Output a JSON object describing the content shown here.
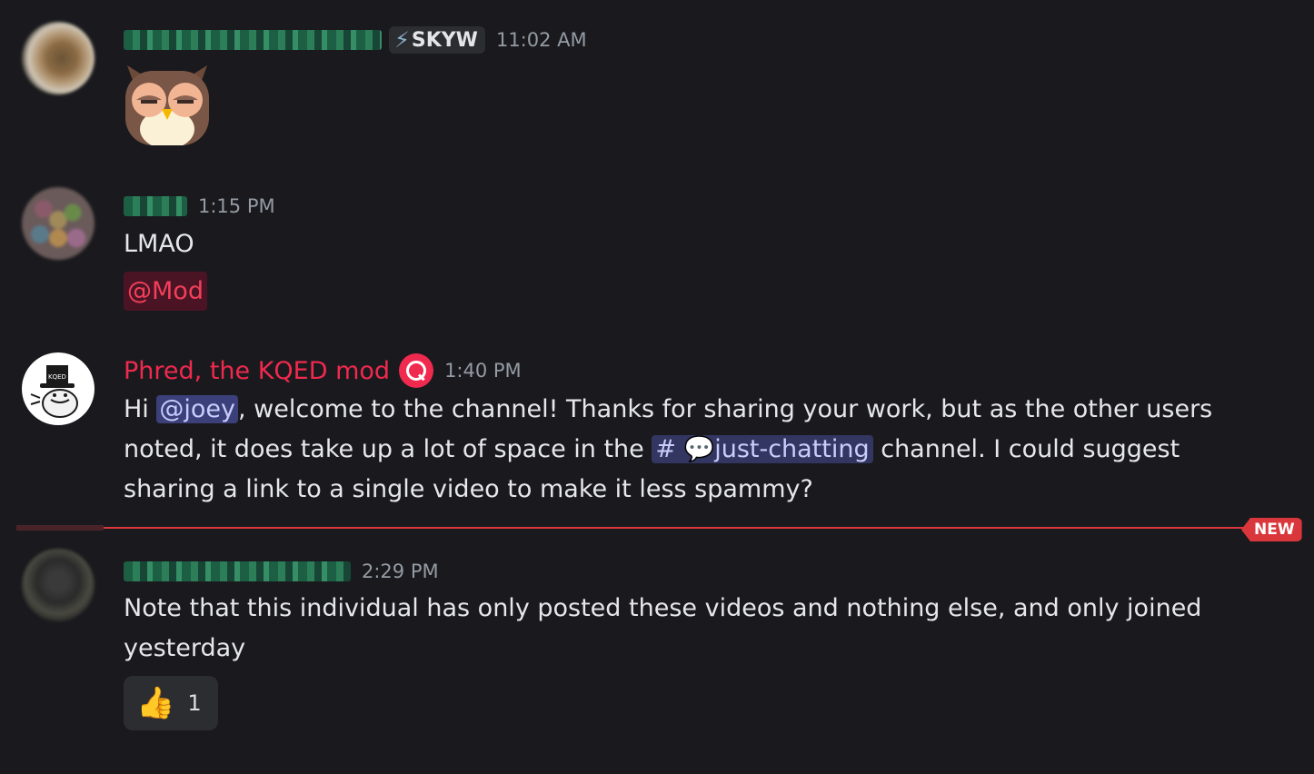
{
  "messages": [
    {
      "tag_icon": "lightning-bolt-icon",
      "tag_icon_glyph": "⚡",
      "tag_label": "SKYW",
      "time": "11:02 AM",
      "sticker": "sleepy-owl-sticker"
    },
    {
      "time": "1:15 PM",
      "text": "LMAO",
      "role_mention": "@Mod"
    },
    {
      "author": "Phred, the KQED mod",
      "badge_icon": "kqed-q-badge-icon",
      "time": "1:40 PM",
      "line1_pre": "Hi ",
      "user_mention": "@joey",
      "line1_post": ", welcome to the channel! Thanks for sharing your work, but as the other users",
      "line2_pre": "noted, it does take up a lot of space in the ",
      "channel_hash": "#",
      "channel_emoji": "💬",
      "channel_name": "just-chatting",
      "line2_post": " channel. I could suggest",
      "line3": "sharing a link to a single video to make it less spammy?"
    },
    {
      "time": "2:29 PM",
      "line1": "Note that this individual has only posted these videos and nothing else, and only joined",
      "line2": "yesterday",
      "reaction_emoji": "👍",
      "reaction_count": "1"
    }
  ],
  "divider": {
    "label": "NEW"
  },
  "colors": {
    "background": "#1a1a1e",
    "mod_red": "#f0294e",
    "new_divider": "#da373c",
    "mention_bg": "#3b3f7a",
    "timestamp": "#949ba4"
  }
}
